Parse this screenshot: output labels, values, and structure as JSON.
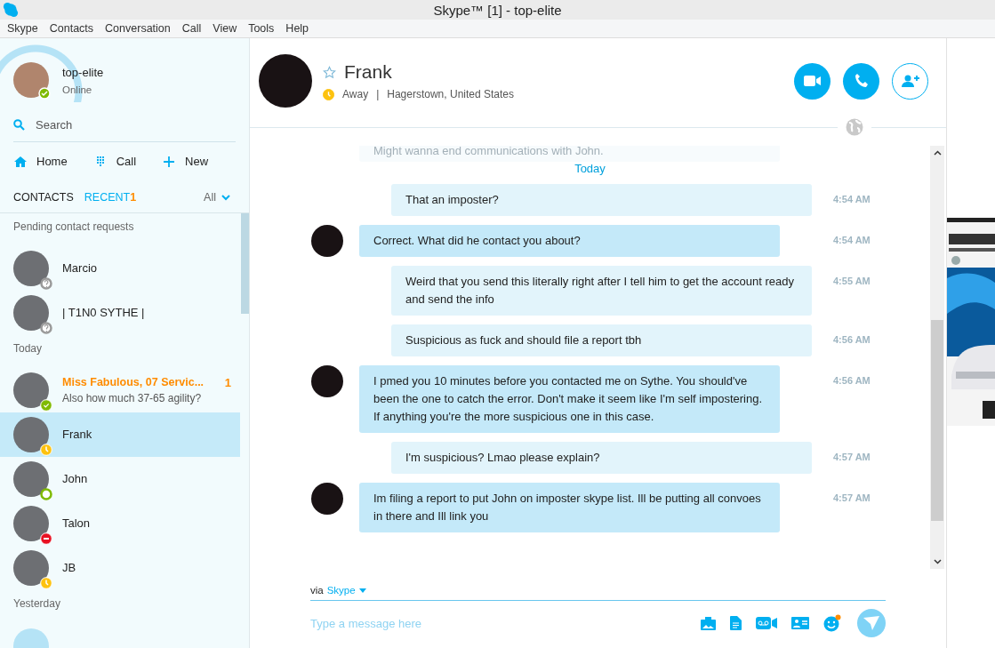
{
  "window": {
    "title": "Skype™ [1] - top-elite"
  },
  "menu": [
    "Skype",
    "Contacts",
    "Conversation",
    "Call",
    "View",
    "Tools",
    "Help"
  ],
  "profile": {
    "name": "top-elite",
    "status_text": "Online",
    "badge": {
      "kind": "online",
      "color": "#7fba00"
    }
  },
  "search": {
    "placeholder": "Search"
  },
  "nav": [
    {
      "label": "Home",
      "kind": "home"
    },
    {
      "label": "Call",
      "kind": "dialpad"
    },
    {
      "label": "New",
      "kind": "plus"
    }
  ],
  "tabs": [
    {
      "label": "CONTACTS",
      "selected": false
    },
    {
      "label": "RECENT",
      "selected": true,
      "badge": "1"
    }
  ],
  "filter": {
    "label": "All"
  },
  "groups": [
    {
      "heading": "Pending contact requests",
      "contacts": [
        {
          "name": "Marcio",
          "badge": {
            "kind": "unknown",
            "color": "#9a9a9a"
          },
          "selected": false,
          "unread": false
        },
        {
          "name": "| T1N0 SYTHE |",
          "badge": {
            "kind": "unknown",
            "color": "#9a9a9a"
          },
          "selected": false,
          "unread": false
        }
      ]
    },
    {
      "heading": "Today",
      "contacts": [
        {
          "name": "Miss Fabulous, 07 Servic...",
          "preview": "Also how much 37-65 agility?",
          "count": "1",
          "badge": {
            "kind": "online",
            "color": "#7fba00"
          },
          "selected": false,
          "unread": true
        },
        {
          "name": "Frank",
          "badge": {
            "kind": "away",
            "color": "#fdc20f"
          },
          "selected": true,
          "unread": false
        },
        {
          "name": "John",
          "badge": {
            "kind": "offline",
            "color": "#7fba00"
          },
          "selected": false,
          "unread": false
        },
        {
          "name": "Talon",
          "badge": {
            "kind": "busy",
            "color": "#e81123"
          },
          "selected": false,
          "unread": false
        },
        {
          "name": "JB",
          "badge": {
            "kind": "away",
            "color": "#fdc20f"
          },
          "selected": false,
          "unread": false
        }
      ]
    },
    {
      "heading": "Yesterday"
    }
  ],
  "chat": {
    "name": "Frank",
    "badge": {
      "kind": "away",
      "color": "#fdc20f"
    },
    "status_text": "Away",
    "separator": "|",
    "location": "Hagerstown, United States"
  },
  "messages": [
    {
      "kind": "faded",
      "text": "Might wanna end communications with John."
    },
    {
      "kind": "date",
      "text": "Today"
    },
    {
      "kind": "outgoing",
      "text": "That an imposter?",
      "time": "4:54 AM"
    },
    {
      "kind": "incoming",
      "text": "Correct. What did he contact you about?",
      "time": "4:54 AM"
    },
    {
      "kind": "outgoing",
      "text": "Weird that you send this literally right after I tell him to get the account ready and send the info",
      "time": "4:55 AM"
    },
    {
      "kind": "outgoing",
      "text": "Suspicious as fuck and should file a report tbh",
      "time": "4:56 AM"
    },
    {
      "kind": "incoming",
      "text": "I pmed you 10 minutes before you contacted me on Sythe. You should've been the one to catch the error. Don't make it seem like I'm self impostering. If anything you're the more suspicious one in this case.",
      "time": "4:56 AM"
    },
    {
      "kind": "outgoing",
      "text": "I'm suspicious? Lmao please explain?",
      "time": "4:57 AM"
    },
    {
      "kind": "incoming",
      "text": "Im filing a report to put John on imposter skype list. Ill be putting all convoes in there and Ill link you",
      "time": "4:57 AM"
    }
  ],
  "composer": {
    "via": "via",
    "service": "Skype",
    "placeholder": "Type a message here"
  }
}
